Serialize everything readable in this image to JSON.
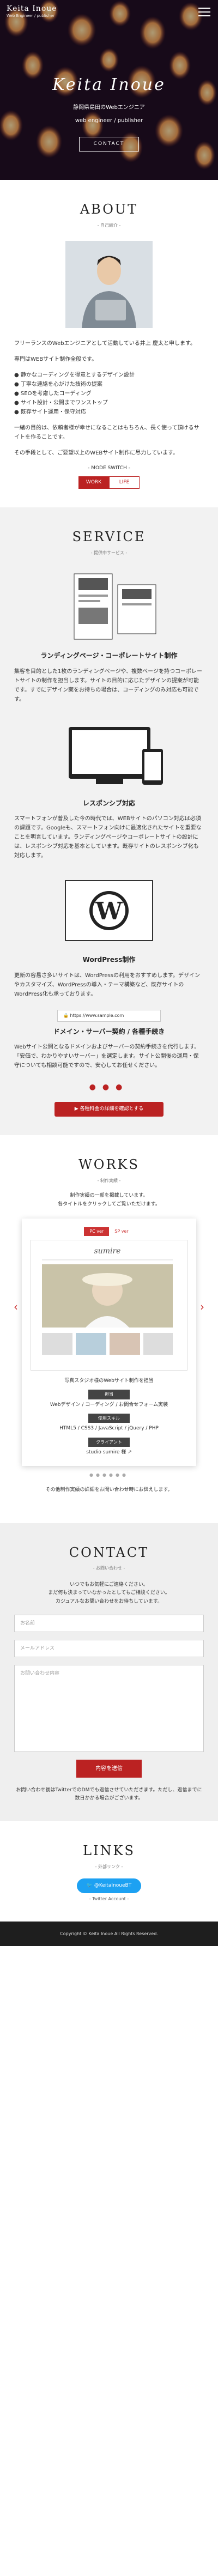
{
  "header": {
    "brand": "Keita Inoue",
    "sub": "Web Engineer / publisher"
  },
  "hero": {
    "title": "Keita Inoue",
    "catch1": "静岡県島田のWebエンジニア",
    "catch2": "web engineer / publisher",
    "button": "CONTACT"
  },
  "about": {
    "title": "ABOUT",
    "sub": "- 自己紹介 -",
    "p1": "フリーランスのWebエンジニアとして活動している井上 慶太と申します。",
    "p2": "専門はWEBサイト制作全般です。",
    "list": [
      "● 静かなコーディングを得意とするデザイン設計",
      "● 丁寧な連絡を心がけた技術の提案",
      "● SEOを考慮したコーディング",
      "● サイト設計・公開までワンストップ",
      "● 既存サイト運用・保守対応"
    ],
    "p3": "一緒の目的は、依頼者様が幸せになることはもちろん、長く使って頂けるサイトを作ることです。",
    "p4": "その手段として、ご要望以上のWEBサイト制作に尽力しています。",
    "mode_label": "- MODE SWITCH -",
    "mode_on": "WORK",
    "mode_off": "LIFE"
  },
  "service": {
    "title": "SERVICE",
    "sub": "- 提供中サービス -",
    "items": [
      {
        "h": "ランディングページ・コーポレートサイト制作",
        "p": "集客を目的とした1枚のランディングページや、複数ページを持つコーポレートサイトの制作を担当します。サイトの目的に応じたデザインの提案が可能です。すでにデザイン案をお持ちの場合は、コーディングのみ対応も可能です。"
      },
      {
        "h": "レスポンシブ対応",
        "p": "スマートフォンが普及した今の時代では、WEBサイトのパソコン対応は必須の課題です。Googleも、スマートフォン向けに最適化されたサイトを重要なことを明言しています。ランディングページやコーポレートサイトの設計には、レスポンシブ対応を基本としています。既存サイトのレスポンシブ化も対応します。"
      },
      {
        "h": "WordPress制作",
        "p": "更新の容易さ多いサイトは、WordPressの利用をおすすめします。デザインやカスタマイズ、WordPressの導入・テーマ構築など、既存サイトのWordPress化も承っております。"
      },
      {
        "h": "ドメイン・サーバー契約 / 各種手続き",
        "p": "Webサイト公開となるドメインおよびサーバーの契約手続きを代行します。「安価で、わかりやすいサーバー」を選定します。サイト公開後の運用・保守についても相談可能ですので、安心してお任せください。"
      }
    ],
    "url_sample": "https://www.sample.com",
    "button": "▶ 各種料金の詳細を確認とする"
  },
  "works": {
    "title": "WORKS",
    "sub": "- 制作実績 -",
    "intro1": "制作実績の一部を掲載しています。",
    "intro2": "各タイトルをクリックしてご覧いただけます。",
    "tab_on": "PC ver",
    "tab_off": "SP ver",
    "mock_logo": "sumire",
    "work_title": "写真スタジオ様のWebサイト制作を担当",
    "tag1": "担当",
    "text1": "Webデザイン / コーディング / お問合せフォーム実装",
    "tag2": "使用スキル",
    "text2": "HTML5 / CSS3 / JavaScript / jQuery / PHP",
    "tag3": "クライアント",
    "text3": "studio sumire 様",
    "note": "その他制作実績の詳細をお問い合わせ時にお伝えします。"
  },
  "contact": {
    "title": "CONTACT",
    "sub": "- お問い合わせ -",
    "p1": "いつでもお気軽にご連絡ください。",
    "p2": "まだ何も決まっていなかったとしてもご相談ください。",
    "p3": "カジュアルなお問い合わせをお待ちしています。",
    "ph_name": "お名前",
    "ph_email": "メールアドレス",
    "ph_msg": "お問い合わせ内容",
    "button": "内容を送信",
    "note": "お問い合わせ後はTwitterでのDMでも返信させていただきます。ただし、返信までに数日かかる場合がございます。"
  },
  "links": {
    "title": "LINKS",
    "sub": "- 外部リンク -",
    "tw": "@KeitaInoueBT",
    "tw_sub": "- Twitter Account -"
  },
  "footer": "Copyright © Keita Inoue All Rights Reserved."
}
